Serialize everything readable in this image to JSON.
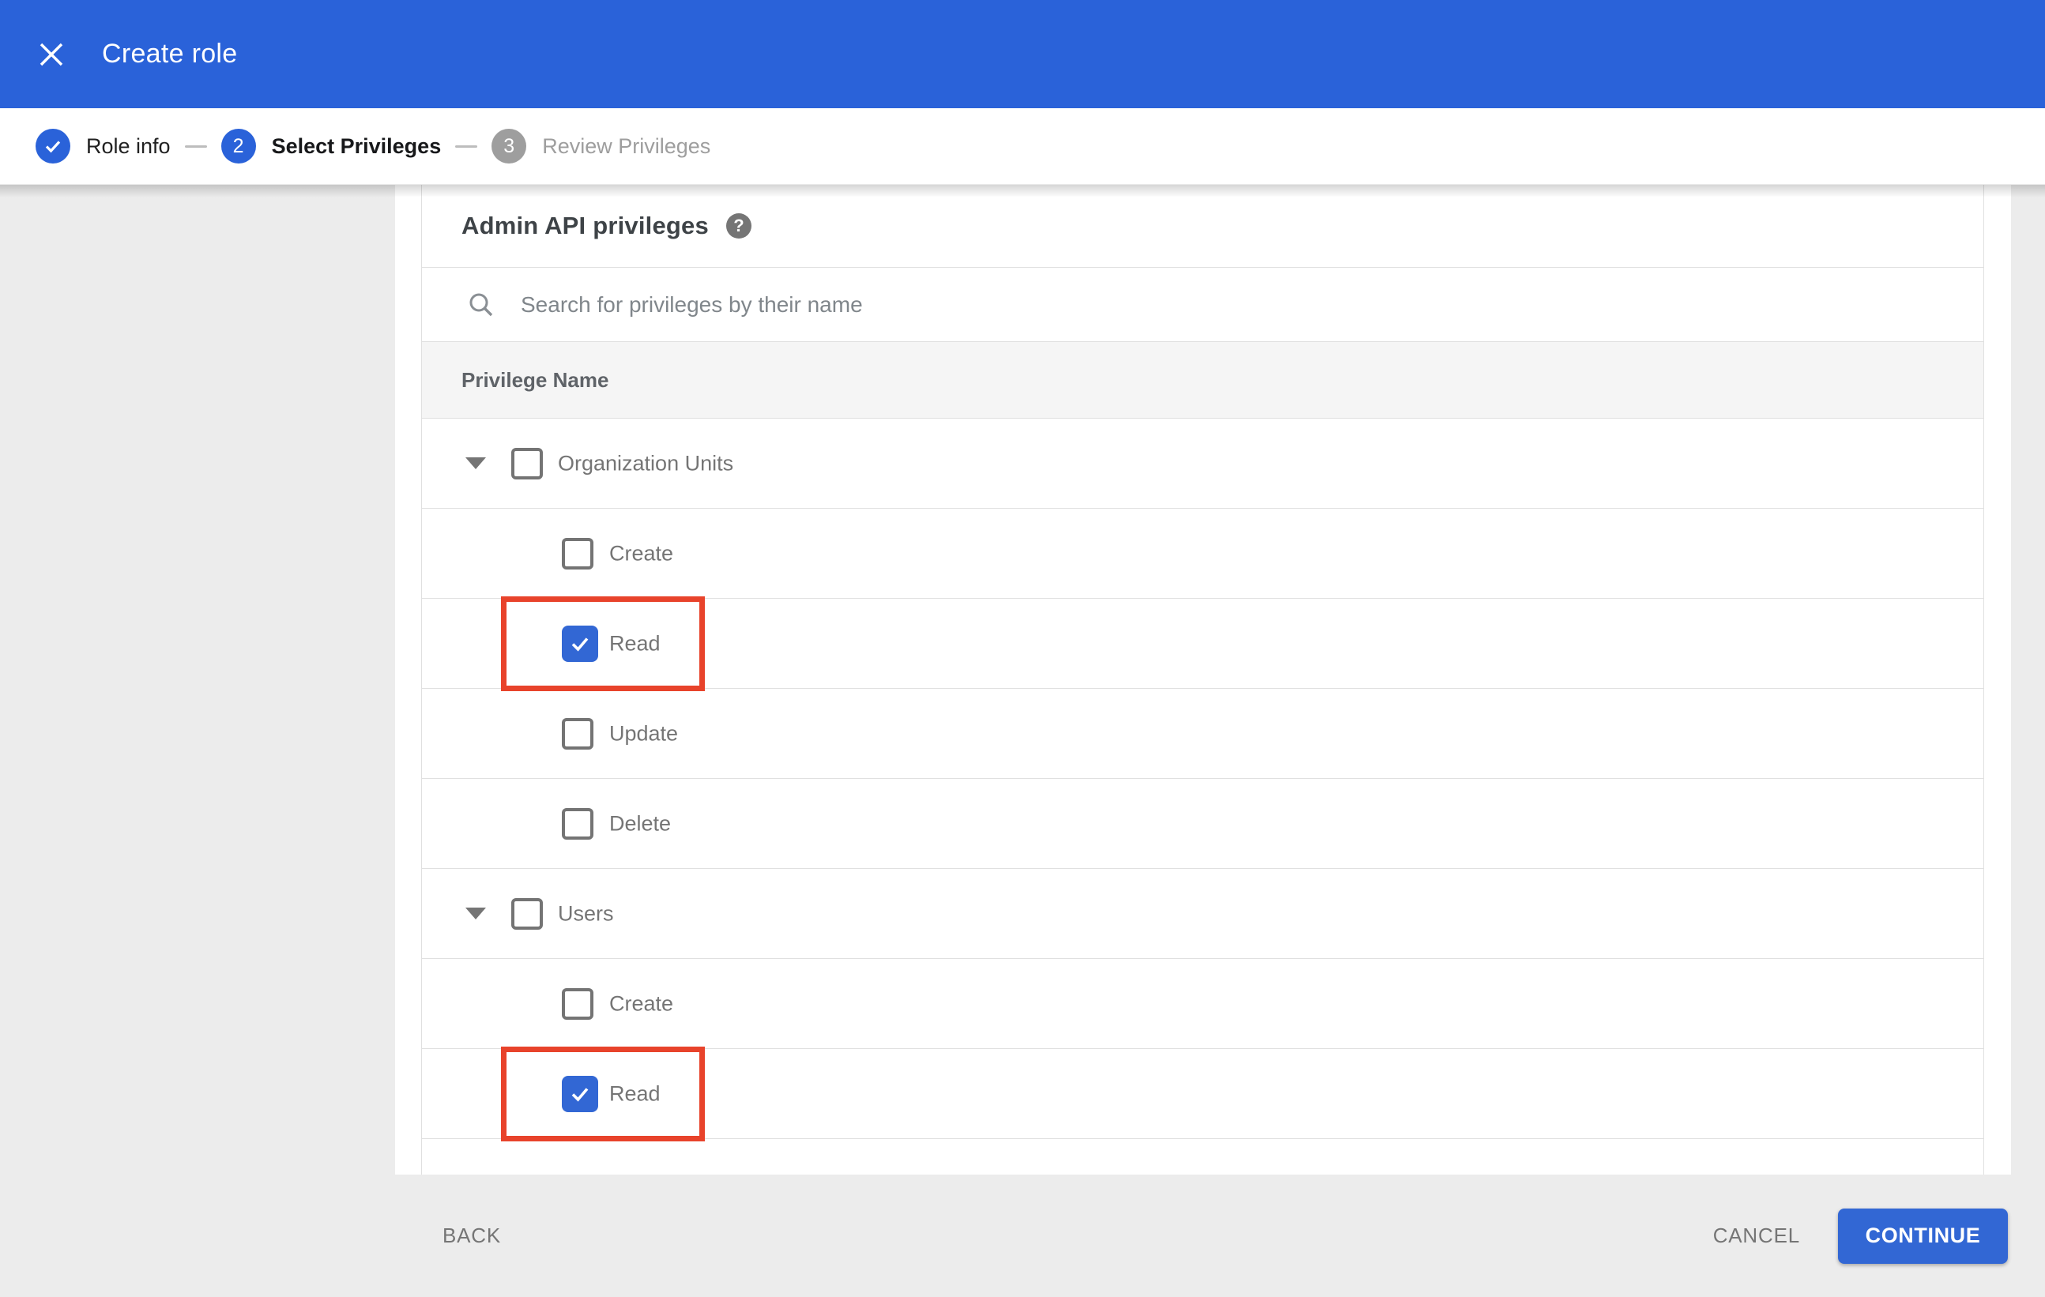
{
  "app_bar": {
    "title": "Create role"
  },
  "stepper": {
    "steps": [
      {
        "label": "Role info",
        "indicator": "check",
        "status": "complete"
      },
      {
        "label": "Select Privileges",
        "indicator": "2",
        "status": "active"
      },
      {
        "label": "Review Privileges",
        "indicator": "3",
        "status": "upcoming"
      }
    ]
  },
  "panel": {
    "title": "Admin API privileges",
    "help_glyph": "?",
    "search": {
      "placeholder": "Search for privileges by their name",
      "value": ""
    },
    "table": {
      "header": "Privilege Name",
      "rows": [
        {
          "label": "Organization Units",
          "level": "parent",
          "expanded": true,
          "checked": false,
          "highlighted": false
        },
        {
          "label": "Create",
          "level": "child",
          "checked": false,
          "highlighted": false
        },
        {
          "label": "Read",
          "level": "child",
          "checked": true,
          "highlighted": true
        },
        {
          "label": "Update",
          "level": "child",
          "checked": false,
          "highlighted": false
        },
        {
          "label": "Delete",
          "level": "child",
          "checked": false,
          "highlighted": false
        },
        {
          "label": "Users",
          "level": "parent",
          "expanded": true,
          "checked": false,
          "highlighted": false
        },
        {
          "label": "Create",
          "level": "child",
          "checked": false,
          "highlighted": false
        },
        {
          "label": "Read",
          "level": "child",
          "checked": true,
          "highlighted": true
        }
      ]
    }
  },
  "footer": {
    "back_label": "BACK",
    "cancel_label": "CANCEL",
    "continue_label": "CONTINUE"
  },
  "colors": {
    "app_bar_blue": "#2a62d9",
    "primary_blue": "#3267d4",
    "highlight_red": "#e8432b",
    "inactive_gray": "#9e9e9e",
    "page_gray": "#ececec"
  }
}
